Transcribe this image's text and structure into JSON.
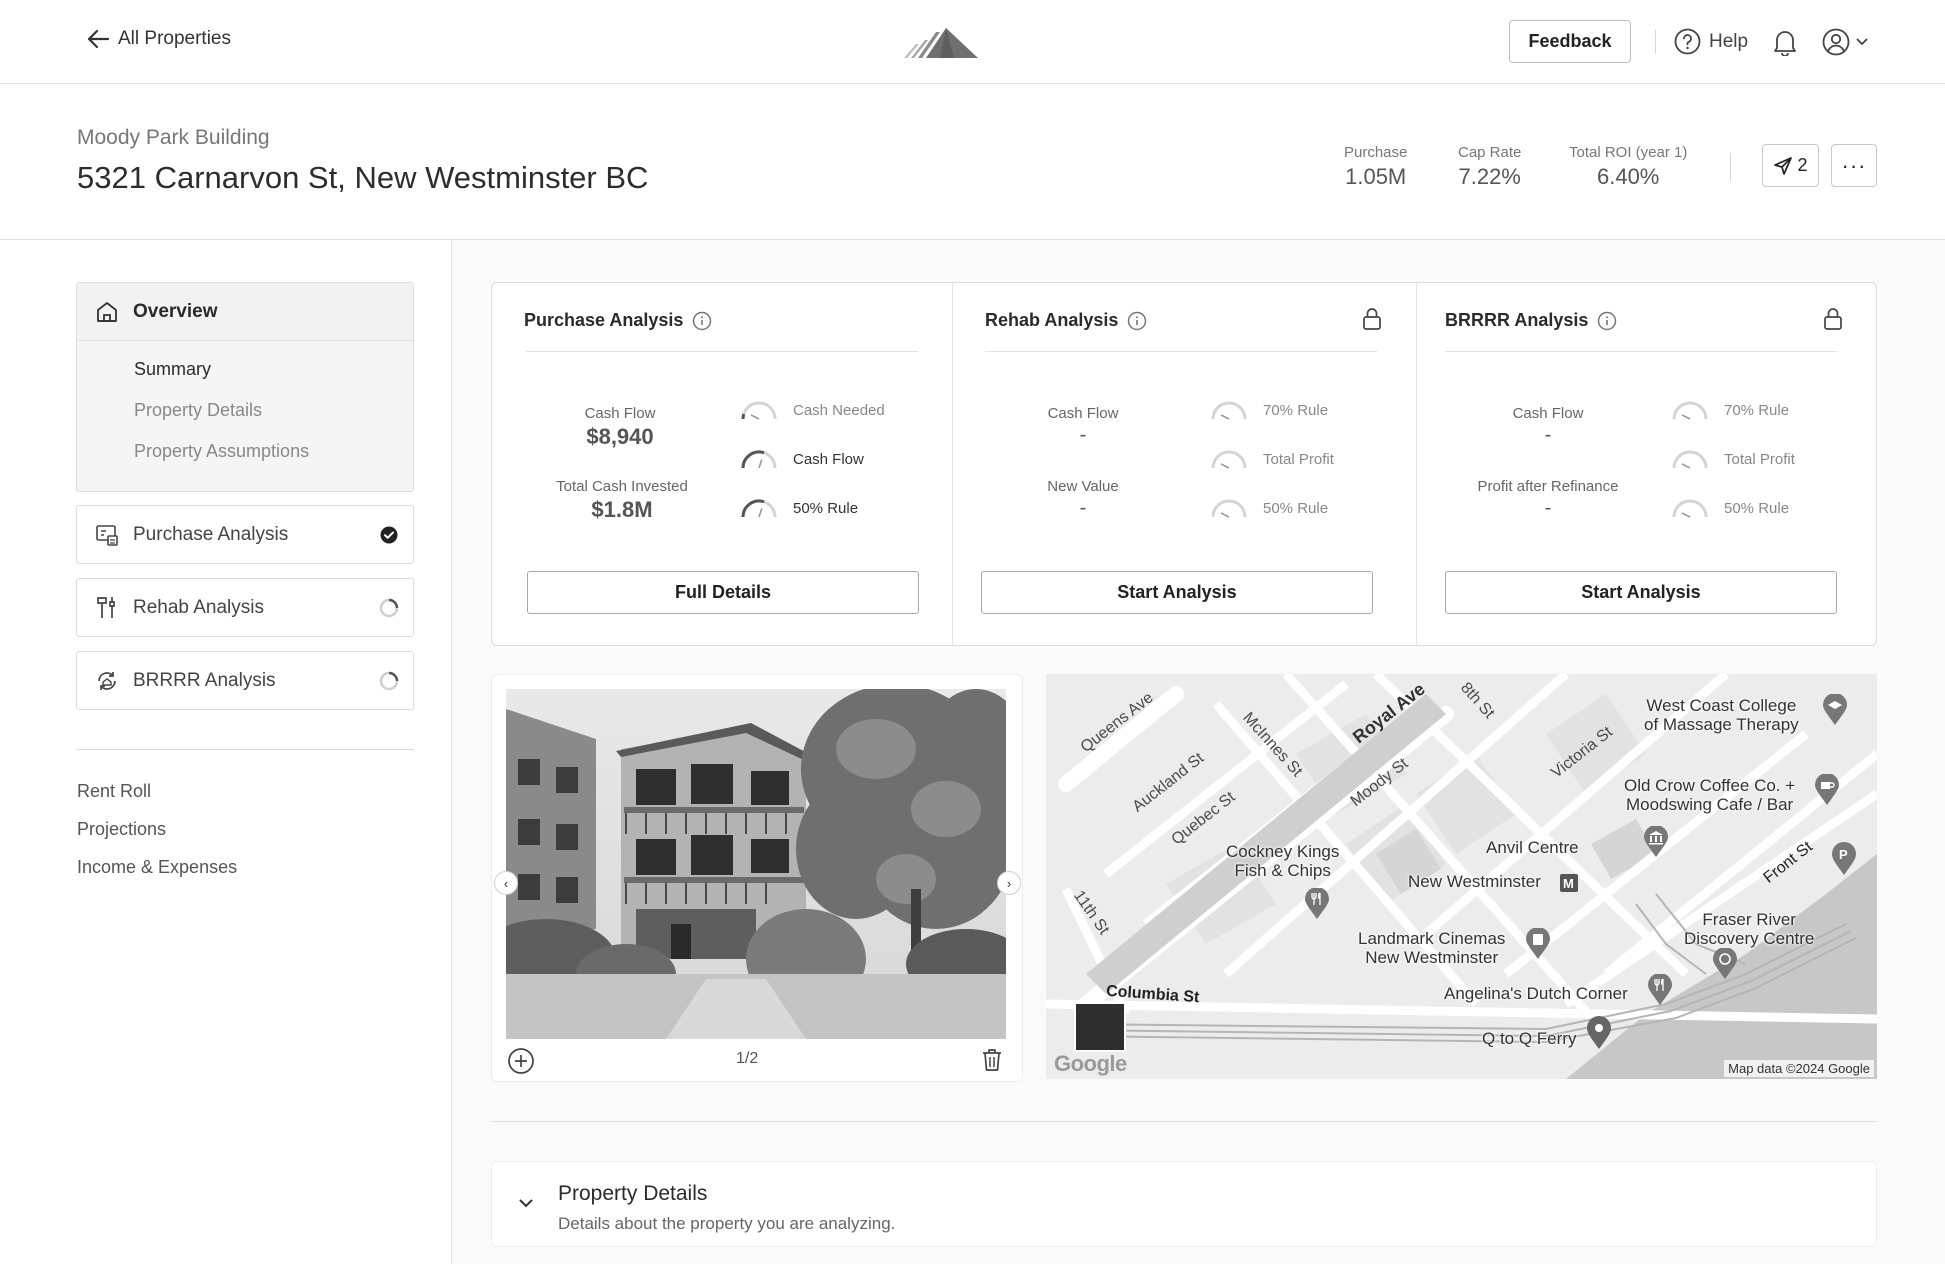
{
  "topbar": {
    "back_label": "All Properties",
    "feedback_label": "Feedback",
    "help_label": "Help"
  },
  "property": {
    "name": "Moody Park Building",
    "address": "5321 Carnarvon St, New Westminster BC",
    "kpis": [
      {
        "label": "Purchase",
        "value": "1.05M"
      },
      {
        "label": "Cap Rate",
        "value": "7.22%"
      },
      {
        "label": "Total ROI (year 1)",
        "value": "6.40%"
      }
    ],
    "share_count": "2",
    "more_label": "···"
  },
  "sidebar": {
    "overview_label": "Overview",
    "sub_items": [
      "Summary",
      "Property Details",
      "Property Assumptions"
    ],
    "analysis_items": [
      {
        "label": "Purchase Analysis",
        "status": "complete"
      },
      {
        "label": "Rehab Analysis",
        "status": "pending"
      },
      {
        "label": "BRRRR Analysis",
        "status": "pending"
      }
    ],
    "links": [
      "Rent Roll",
      "Projections",
      "Income & Expenses"
    ]
  },
  "analysis_cards": [
    {
      "title": "Purchase Analysis",
      "locked": false,
      "metrics": [
        {
          "label": "Cash Flow",
          "value": "$8,940"
        },
        {
          "label": "Total Cash Invested",
          "value": "$1.8M"
        }
      ],
      "gauges": [
        {
          "label": "Cash Needed",
          "level": 0.1
        },
        {
          "label": "Cash Flow",
          "level": 0.6
        },
        {
          "label": "50% Rule",
          "level": 0.6
        }
      ],
      "button_label": "Full Details"
    },
    {
      "title": "Rehab Analysis",
      "locked": true,
      "metrics": [
        {
          "label": "Cash Flow",
          "value": "-"
        },
        {
          "label": "New Value",
          "value": "-"
        }
      ],
      "gauges": [
        {
          "label": "70% Rule",
          "level": 0
        },
        {
          "label": "Total Profit",
          "level": 0
        },
        {
          "label": "50% Rule",
          "level": 0
        }
      ],
      "button_label": "Start Analysis"
    },
    {
      "title": "BRRRR Analysis",
      "locked": true,
      "metrics": [
        {
          "label": "Cash Flow",
          "value": "-"
        },
        {
          "label": "Profit after Refinance",
          "value": "-"
        }
      ],
      "gauges": [
        {
          "label": "70% Rule",
          "level": 0
        },
        {
          "label": "Total Profit",
          "level": 0
        },
        {
          "label": "50% Rule",
          "level": 0
        }
      ],
      "button_label": "Start Analysis"
    }
  ],
  "photo": {
    "counter": "1/2"
  },
  "map": {
    "streets": [
      "Queens Ave",
      "Royal Ave",
      "8th St",
      "McInnes St",
      "Auckland St",
      "Quebec St",
      "Moody St",
      "Victoria St",
      "11th St",
      "Columbia St",
      "Front St"
    ],
    "pois": [
      {
        "name": "West Coast College\nof Massage Therapy",
        "icon": "school-icon"
      },
      {
        "name": "Old Crow Coffee Co. +\nMoodswing Cafe / Bar",
        "icon": "cafe-icon"
      },
      {
        "name": "Anvil Centre",
        "icon": "museum-icon"
      },
      {
        "name": "Cockney Kings\nFish & Chips",
        "icon": "restaurant-icon"
      },
      {
        "name": "New Westminster",
        "icon": "metro-icon"
      },
      {
        "name": "Landmark Cinemas\nNew Westminster",
        "icon": "cinema-icon"
      },
      {
        "name": "Fraser River\nDiscovery Centre",
        "icon": "museum-icon"
      },
      {
        "name": "Angelina's Dutch Corner",
        "icon": "restaurant-icon"
      },
      {
        "name": "Q to Q Ferry",
        "icon": "pin-icon"
      }
    ],
    "attribution": "Map data ©2024 Google",
    "logo_text": "Google"
  },
  "details": {
    "title": "Property Details",
    "subtitle": "Details about the property you are analyzing."
  }
}
